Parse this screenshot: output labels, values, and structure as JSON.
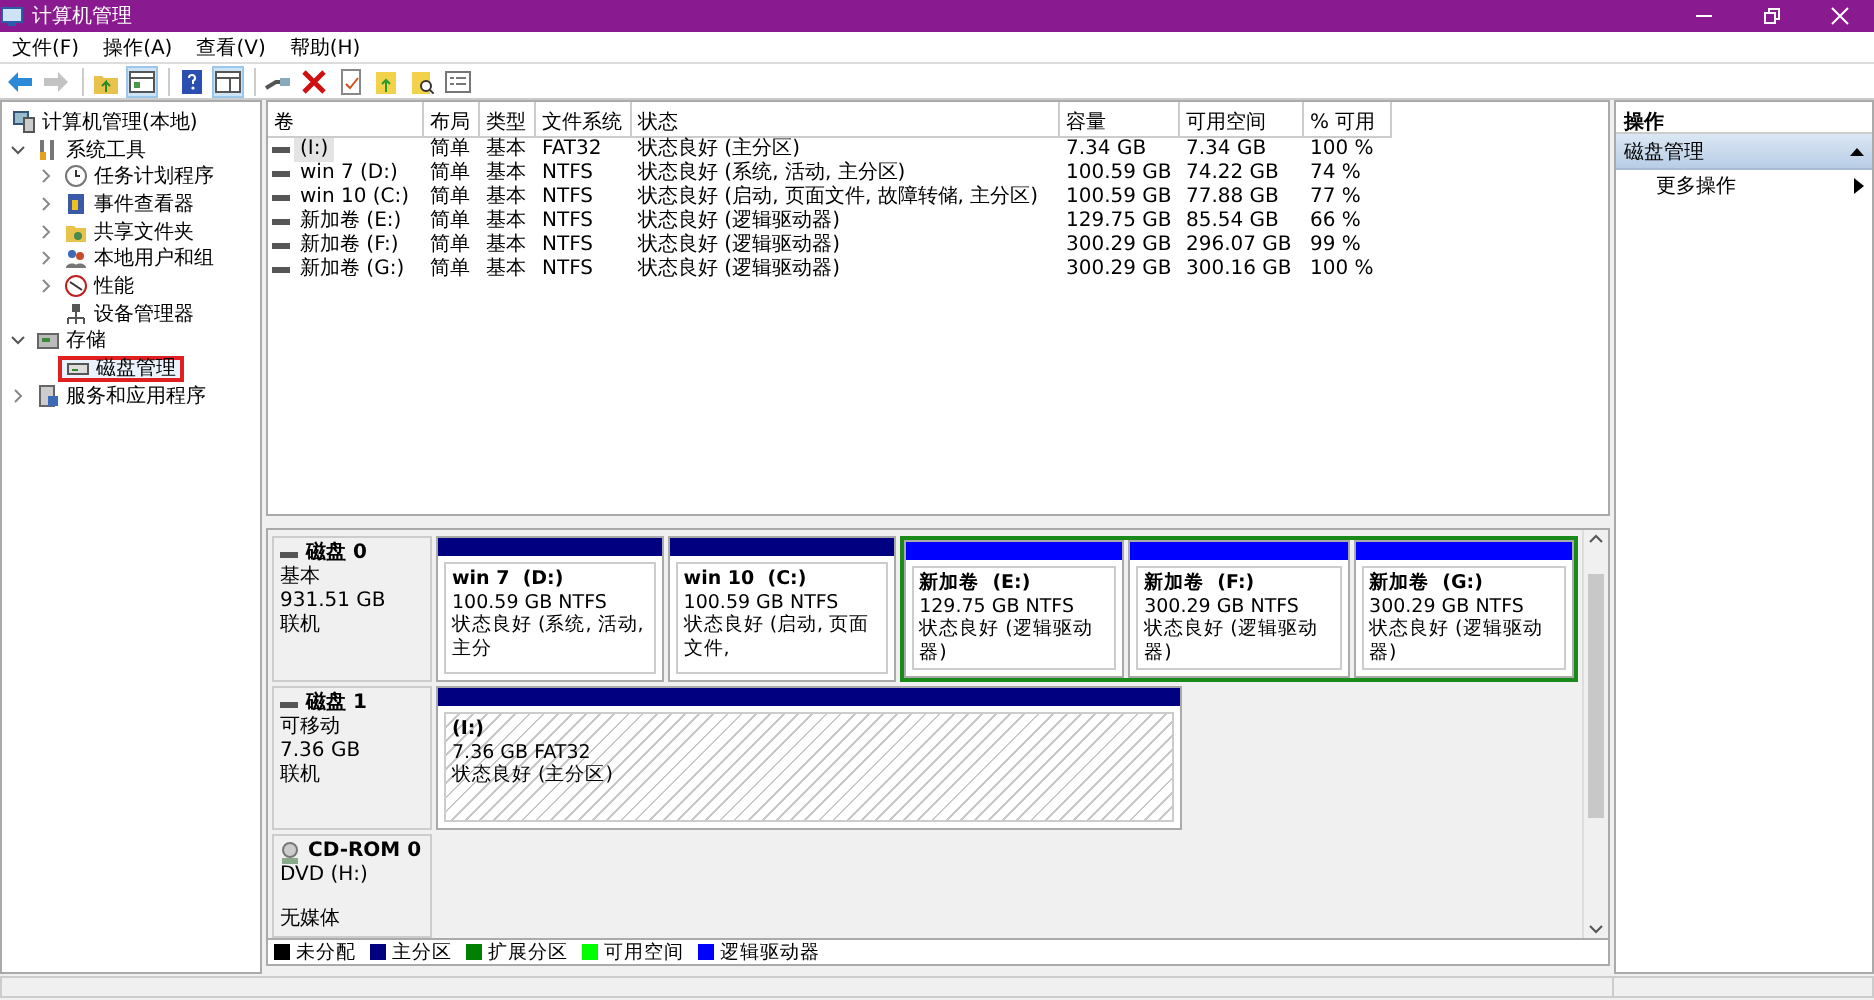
{
  "window": {
    "title": "计算机管理"
  },
  "menu": [
    "文件(F)",
    "操作(A)",
    "查看(V)",
    "帮助(H)"
  ],
  "toolbar": [
    {
      "pressed": false,
      "disabled": false
    },
    {
      "pressed": false,
      "disabled": true
    },
    {
      "pressed": false,
      "disabled": false
    },
    {
      "pressed": true,
      "disabled": false
    },
    {
      "pressed": false,
      "disabled": false
    },
    {
      "pressed": true,
      "disabled": false
    },
    {
      "pressed": false,
      "disabled": false
    },
    {
      "pressed": false,
      "disabled": false
    },
    {
      "pressed": false,
      "disabled": false
    },
    {
      "pressed": false,
      "disabled": false
    },
    {
      "pressed": false,
      "disabled": false
    },
    {
      "pressed": false,
      "disabled": false
    }
  ],
  "tree": [
    {
      "label": "计算机管理(本地)",
      "selected": false,
      "children": [
        {
          "label": "系统工具",
          "expanded": true,
          "selected": false,
          "children": [
            {
              "label": "任务计划程序",
              "expanded": false,
              "selected": false
            },
            {
              "label": "事件查看器",
              "expanded": false,
              "selected": false
            },
            {
              "label": "共享文件夹",
              "expanded": false,
              "selected": false
            },
            {
              "label": "本地用户和组",
              "expanded": false,
              "selected": false
            },
            {
              "label": "性能",
              "expanded": false,
              "selected": false
            },
            {
              "label": "设备管理器",
              "selected": false
            }
          ]
        },
        {
          "label": "存储",
          "expanded": true,
          "selected": false,
          "children": [
            {
              "label": "磁盘管理",
              "selected": true
            }
          ]
        },
        {
          "label": "服务和应用程序",
          "expanded": false,
          "selected": false
        }
      ]
    }
  ],
  "volumes": {
    "columns": [
      "卷",
      "布局",
      "类型",
      "文件系统",
      "状态",
      "容量",
      "可用空间",
      "% 可用"
    ],
    "rows": [
      {
        "selected": true,
        "cells": [
          "(I:)",
          "简单",
          "基本",
          "FAT32",
          "状态良好 (主分区)",
          "7.34 GB",
          "7.34 GB",
          "100 %"
        ]
      },
      {
        "selected": false,
        "cells": [
          "win 7 (D:)",
          "简单",
          "基本",
          "NTFS",
          "状态良好 (系统, 活动, 主分区)",
          "100.59 GB",
          "74.22 GB",
          "74 %"
        ]
      },
      {
        "selected": false,
        "cells": [
          "win 10 (C:)",
          "简单",
          "基本",
          "NTFS",
          "状态良好 (启动, 页面文件, 故障转储, 主分区)",
          "100.59 GB",
          "77.88 GB",
          "77 %"
        ]
      },
      {
        "selected": false,
        "cells": [
          "新加卷 (E:)",
          "简单",
          "基本",
          "NTFS",
          "状态良好 (逻辑驱动器)",
          "129.75 GB",
          "85.54 GB",
          "66 %"
        ]
      },
      {
        "selected": false,
        "cells": [
          "新加卷 (F:)",
          "简单",
          "基本",
          "NTFS",
          "状态良好 (逻辑驱动器)",
          "300.29 GB",
          "296.07 GB",
          "99 %"
        ]
      },
      {
        "selected": false,
        "cells": [
          "新加卷 (G:)",
          "简单",
          "基本",
          "NTFS",
          "状态良好 (逻辑驱动器)",
          "300.29 GB",
          "300.16 GB",
          "100 %"
        ]
      }
    ]
  },
  "disks": [
    {
      "kind": "disk",
      "name": "磁盘 0",
      "type": "基本",
      "size": "931.51 GB",
      "status": "联机",
      "partitions": [
        {
          "kind": "primary",
          "name": "win 7  (D:)",
          "size": "100.59 GB NTFS",
          "status": "状态良好 (系统, 活动, 主分",
          "selected": false
        },
        {
          "kind": "primary",
          "name": "win 10  (C:)",
          "size": "100.59 GB NTFS",
          "status": "状态良好 (启动, 页面文件,",
          "selected": false
        },
        {
          "kind": "extended",
          "children": [
            {
              "kind": "logical",
              "name": "新加卷  (E:)",
              "size": "129.75 GB NTFS",
              "status": "状态良好 (逻辑驱动器)",
              "selected": false
            },
            {
              "kind": "logical",
              "name": "新加卷  (F:)",
              "size": "300.29 GB NTFS",
              "status": "状态良好 (逻辑驱动器)",
              "selected": false
            },
            {
              "kind": "logical",
              "name": "新加卷  (G:)",
              "size": "300.29 GB NTFS",
              "status": "状态良好 (逻辑驱动器)",
              "selected": false
            }
          ]
        }
      ]
    },
    {
      "kind": "disk",
      "name": "磁盘 1",
      "type": "可移动",
      "size": "7.36 GB",
      "status": "联机",
      "partitions": [
        {
          "kind": "primary",
          "name": "(I:)",
          "size": "7.36 GB FAT32",
          "status": "状态良好 (主分区)",
          "selected": true
        }
      ]
    },
    {
      "kind": "cdrom",
      "name": "CD-ROM 0",
      "type": "DVD (H:)",
      "status": "无媒体"
    }
  ],
  "legend": [
    {
      "label": "未分配",
      "color": "#000000"
    },
    {
      "label": "主分区",
      "color": "#000080"
    },
    {
      "label": "扩展分区",
      "color": "#008000"
    },
    {
      "label": "可用空间",
      "color": "#00ff00"
    },
    {
      "label": "逻辑驱动器",
      "color": "#0000ff"
    }
  ],
  "actions": {
    "title": "操作",
    "sections": [
      {
        "title": "磁盘管理",
        "expanded": true,
        "items": [
          "更多操作"
        ]
      }
    ]
  }
}
